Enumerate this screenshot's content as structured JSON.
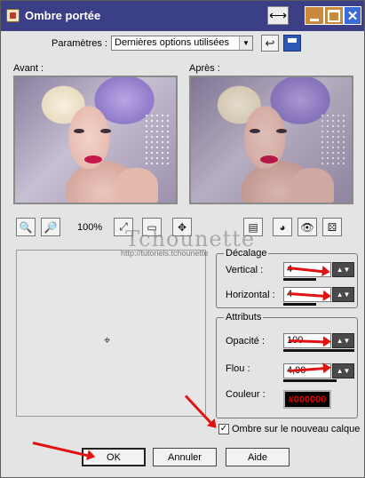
{
  "window": {
    "title": "Ombre portée"
  },
  "presets": {
    "label": "Paramètres :",
    "selected": "Dernières options utilisées"
  },
  "previews": {
    "before_label": "Avant :",
    "after_label": "Après :"
  },
  "zoom": {
    "level": "100%"
  },
  "watermark": {
    "text": "Tchounette",
    "url": "http://tutoriels.tchounette"
  },
  "offset": {
    "title": "Décalage",
    "vertical_label": "Vertical :",
    "vertical_value": "4",
    "horizontal_label": "Horizontal :",
    "horizontal_value": "4"
  },
  "attributes": {
    "title": "Attributs",
    "opacity_label": "Opacité :",
    "opacity_value": "100",
    "blur_label": "Flou :",
    "blur_value": "4,00",
    "color_label": "Couleur :",
    "color_value": "#000000"
  },
  "shadow_option": {
    "label": "Ombre sur le nouveau calque",
    "checked": true
  },
  "buttons": {
    "ok": "OK",
    "cancel": "Annuler",
    "help": "Aide"
  },
  "colors": {
    "titlebar": "#3b3f86",
    "annotation_arrow": "#e01212",
    "color_text": "#e00000"
  }
}
